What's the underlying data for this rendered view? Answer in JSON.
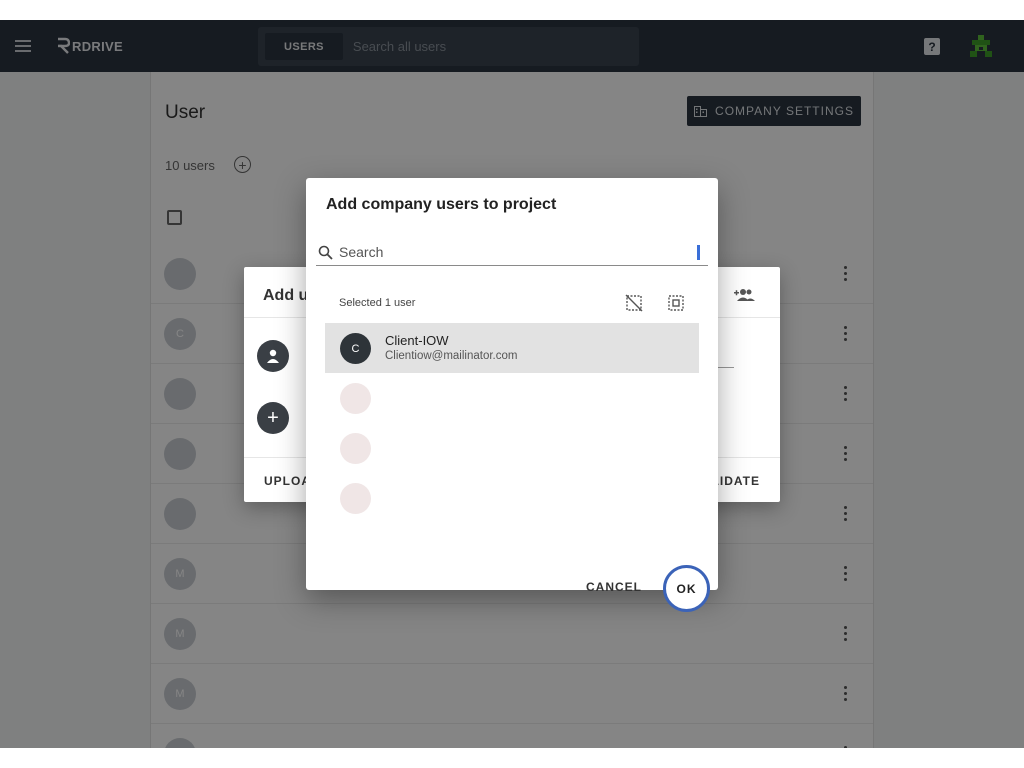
{
  "topbar": {
    "logo_text": "RDRIVE",
    "search_scope": "USERS",
    "search_placeholder": "Search all users",
    "help_label": "?"
  },
  "page": {
    "title": "User",
    "company_settings_label": "COMPANY SETTINGS",
    "users_count": "10 users",
    "add_symbol": "+",
    "rows": [
      {
        "initial": "",
        "name": "",
        "email": ""
      },
      {
        "initial": "C",
        "name": "",
        "email": ""
      },
      {
        "initial": "",
        "name": "",
        "email": ""
      },
      {
        "initial": "",
        "name": "",
        "email": ""
      },
      {
        "initial": "",
        "name": "",
        "email": ""
      },
      {
        "initial": "M",
        "name": "",
        "email": ""
      },
      {
        "initial": "M",
        "name": "",
        "email": ""
      },
      {
        "initial": "M",
        "name": "",
        "email": ""
      },
      {
        "initial": "",
        "name": "",
        "email": ""
      }
    ]
  },
  "under_dialog": {
    "title": "Add u",
    "upload_label": "UPLOA",
    "validate_label": "LIDATE",
    "plus": "+"
  },
  "dialog": {
    "title": "Add company users to project",
    "search_placeholder": "Search",
    "selected_label": "Selected 1 user",
    "users": [
      {
        "initial": "C",
        "name": "Client-IOW",
        "email": "Clientiow@mailinator.com",
        "selected": true
      },
      {
        "initial": "",
        "name": "",
        "email": "",
        "selected": false
      },
      {
        "initial": "",
        "name": "",
        "email": "",
        "selected": false
      },
      {
        "initial": "",
        "name": "",
        "email": "",
        "selected": false
      }
    ],
    "cancel_label": "CANCEL",
    "ok_label": "OK"
  },
  "colors": {
    "topbar": "#2b3440",
    "accent_ring": "#3b63b8",
    "selected_row": "#e2e2e2"
  }
}
